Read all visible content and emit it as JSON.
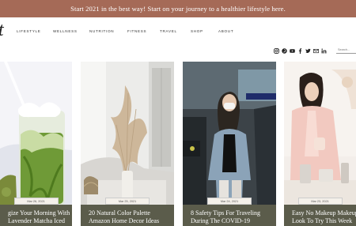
{
  "banner": {
    "text": "Start 2021 in the best way! Start on your journey to a healthier lifestyle here."
  },
  "logo": {
    "text": "t"
  },
  "nav": {
    "items": [
      "LIFESTYLE",
      "WELLNESS",
      "NUTRITION",
      "FITNESS",
      "TRAVEL",
      "SHOP",
      "ABOUT"
    ]
  },
  "social": {
    "icons": [
      "instagram-icon",
      "pinterest-icon",
      "youtube-icon",
      "facebook-icon",
      "twitter-icon",
      "mail-icon",
      "linkedin-icon"
    ]
  },
  "search": {
    "placeholder": "Search..."
  },
  "posts": [
    {
      "date": "Mar 26, 2021",
      "title_line1": "gize Your Morning With",
      "title_line2": "Lavender Matcha Iced"
    },
    {
      "date": "Mar 25, 2021",
      "title_line1": "20 Natural Color Palette",
      "title_line2": "Amazon Home Decor Ideas"
    },
    {
      "date": "Mar 24, 2021",
      "title_line1": "8 Safety Tips For Traveling",
      "title_line2": "During The COVID-19"
    },
    {
      "date": "Mar 23, 2021",
      "title_line1": "Easy No Makeup Makeup",
      "title_line2": "Look To Try This Week"
    }
  ],
  "colors": {
    "banner": "#a56a57",
    "caption": "#5b5c4b"
  }
}
